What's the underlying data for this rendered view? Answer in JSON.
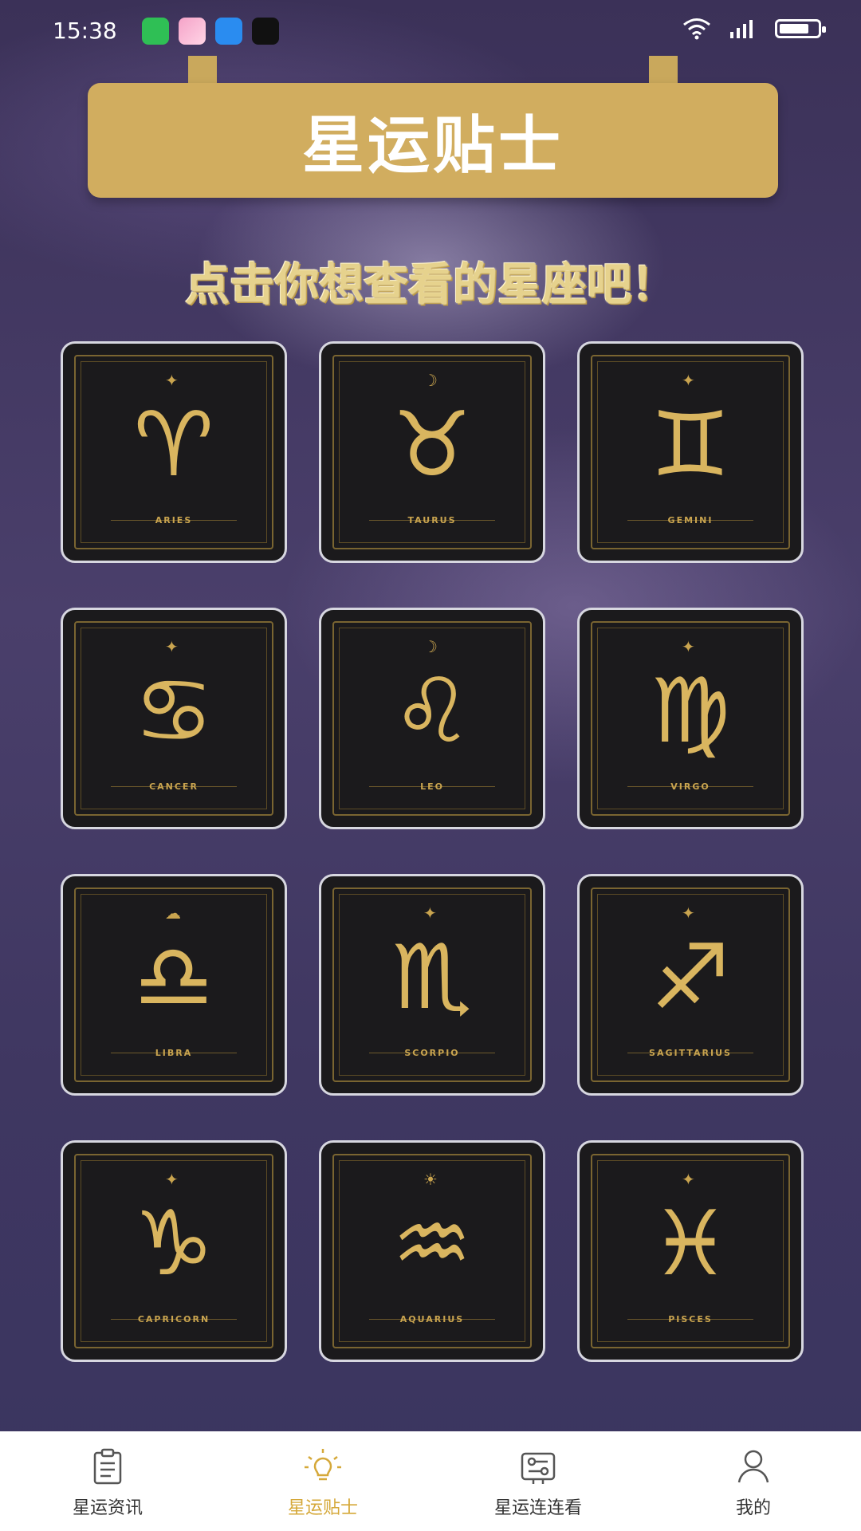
{
  "status_bar": {
    "time": "15:38"
  },
  "banner": {
    "title": "星运贴士"
  },
  "subtitle": "点击你想查看的星座吧！",
  "zodiac_cards": [
    {
      "symbol": "♈",
      "name": "ARIES"
    },
    {
      "symbol": "♉",
      "name": "TAURUS"
    },
    {
      "symbol": "♊",
      "name": "GEMINI"
    },
    {
      "symbol": "♋",
      "name": "CANCER"
    },
    {
      "symbol": "♌",
      "name": "LEO"
    },
    {
      "symbol": "♍",
      "name": "VIRGO"
    },
    {
      "symbol": "♎",
      "name": "LIBRA"
    },
    {
      "symbol": "♏",
      "name": "SCORPIO"
    },
    {
      "symbol": "♐",
      "name": "SAGITTARIUS"
    },
    {
      "symbol": "♑",
      "name": "CAPRICORN"
    },
    {
      "symbol": "♒",
      "name": "AQUARIUS"
    },
    {
      "symbol": "♓",
      "name": "PISCES"
    }
  ],
  "bottom_nav": [
    {
      "label": "星运资讯",
      "icon": "clipboard-icon",
      "active": false
    },
    {
      "label": "星运贴士",
      "icon": "lightbulb-icon",
      "active": true
    },
    {
      "label": "星运连连看",
      "icon": "link-game-icon",
      "active": false
    },
    {
      "label": "我的",
      "icon": "person-icon",
      "active": false
    }
  ],
  "colors": {
    "accent": "#d5a839",
    "gold": "#d1ad5f",
    "card_bg": "#1b1a1c"
  }
}
